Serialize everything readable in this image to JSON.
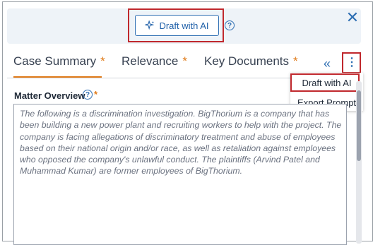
{
  "banner": {
    "draft_button_label": "Draft with AI"
  },
  "tabs": [
    {
      "label": "Case Summary",
      "required": "*"
    },
    {
      "label": "Relevance",
      "required": "*"
    },
    {
      "label": "Key Documents",
      "required": "*"
    }
  ],
  "menu": {
    "items": [
      {
        "label": "Draft with AI"
      },
      {
        "label": "Export Prompt"
      }
    ]
  },
  "matter_overview": {
    "label": "Matter Overview",
    "required": "*",
    "text": "The following is a discrimination investigation. BigThorium is a company that has been building a new power plant and recruiting workers to help with the project. The company is facing allegations of discriminatory treatment and abuse of employees based on their national origin and/or race, as well as retaliation against employees who opposed the company's unlawful conduct. The plaintiffs (Arvind Patel and Muhammad Kumar) are former employees of BigThorium."
  },
  "colors": {
    "accent": "#2f6fb3",
    "highlight": "#c0282d",
    "required": "#e07b1a"
  }
}
